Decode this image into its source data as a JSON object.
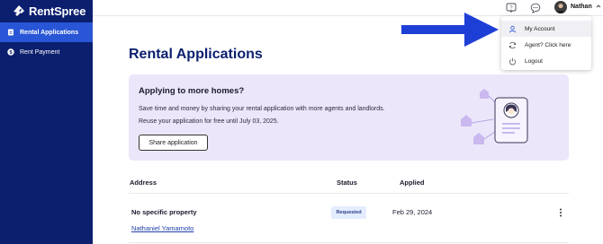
{
  "brand": {
    "name": "RentSpree",
    "color": "#0b1f6e",
    "accent": "#2956d6"
  },
  "sidebar": {
    "items": [
      {
        "label": "Rental Applications",
        "icon": "document-icon",
        "active": true
      },
      {
        "label": "Rent Payment",
        "icon": "dollar-icon",
        "active": false
      }
    ]
  },
  "header": {
    "icons": [
      "help-icon",
      "chat-icon"
    ],
    "user_name": "Nathan"
  },
  "account_menu": {
    "items": [
      {
        "label": "My Account",
        "icon": "user-icon"
      },
      {
        "label": "Agent? Click here",
        "icon": "refresh-icon"
      },
      {
        "label": "Logout",
        "icon": "power-icon"
      }
    ]
  },
  "main": {
    "title": "Rental Applications",
    "banner": {
      "title": "Applying to more homes?",
      "line1": "Save time and money by sharing your rental application with more agents and landlords.",
      "line2": "Reuse your application for free until July 03, 2025.",
      "button": "Share application",
      "background": "#ece6fa"
    },
    "table": {
      "headers": [
        "Address",
        "Status",
        "Applied"
      ],
      "rows": [
        {
          "address": "No specific property",
          "tenant": "Nathaniel Yamamoto",
          "status": "Requested",
          "applied": "Feb 29, 2024"
        }
      ]
    }
  },
  "annotation": {
    "arrow_color": "#1d3fd6"
  }
}
